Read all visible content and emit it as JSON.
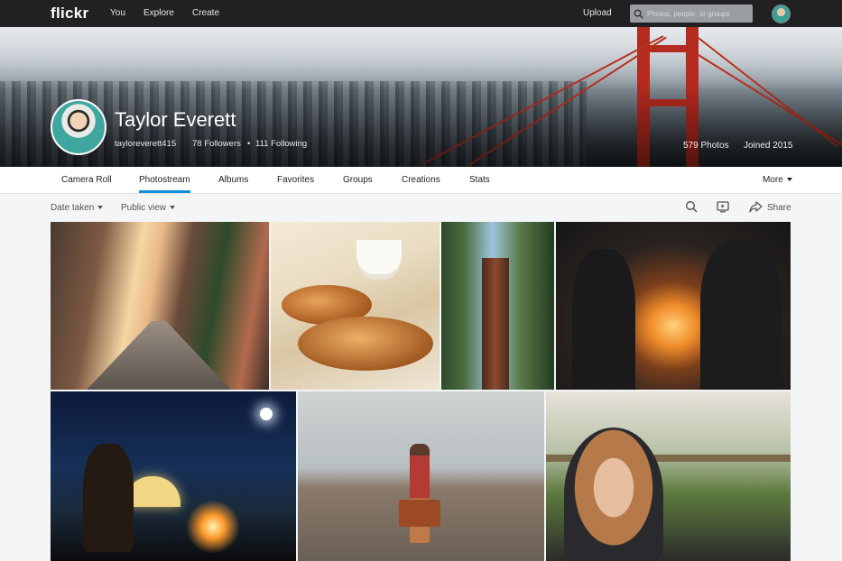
{
  "topbar": {
    "logo": "flickr",
    "nav": [
      "You",
      "Explore",
      "Create"
    ],
    "upload": "Upload",
    "search_placeholder": "Photos, people, or groups"
  },
  "profile": {
    "name": "Taylor Everett",
    "username": "tayloreverett415",
    "followers": "78 Followers",
    "separator": "•",
    "following": "111 Following",
    "photos": "579 Photos",
    "joined": "Joined 2015"
  },
  "tabs": [
    "Camera Roll",
    "Photostream",
    "Albums",
    "Favorites",
    "Groups",
    "Creations",
    "Stats"
  ],
  "active_tab": "Photostream",
  "more": "More",
  "filters": {
    "date": "Date taken",
    "view": "Public view",
    "share": "Share"
  },
  "colors": {
    "topbar": "#212124",
    "accent": "#128fdc",
    "background": "#f3f5f6"
  },
  "icons": [
    "search-icon",
    "slideshow-icon",
    "share-icon",
    "caret-down-icon"
  ]
}
